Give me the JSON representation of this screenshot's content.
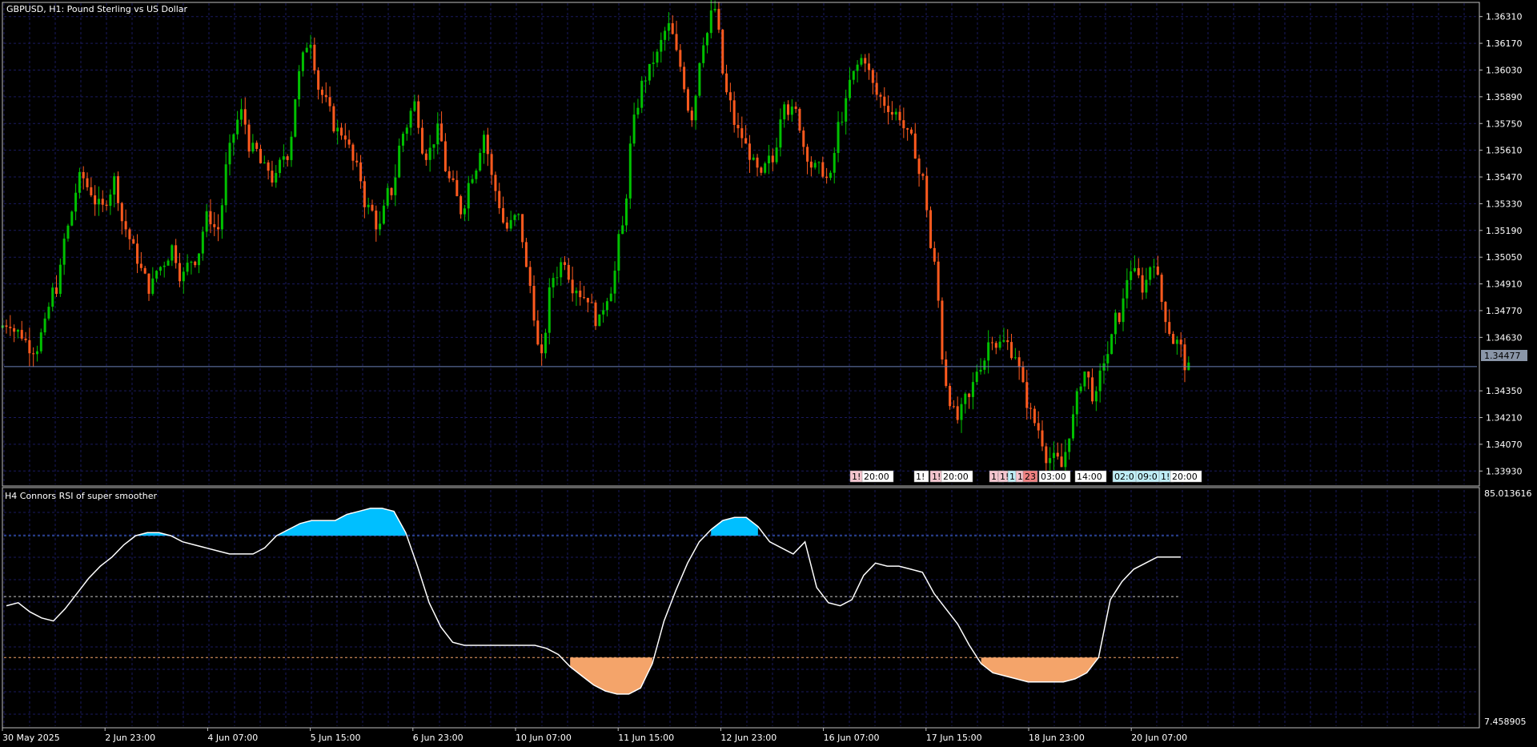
{
  "window": {
    "main_title": "GBPUSD, H1:  Pound Sterling vs US Dollar",
    "indicator_title": "H4 Connors RSI of super smoother"
  },
  "colors": {
    "background": "#000000",
    "frame": "#c0c0c0",
    "grid": "#1a1a5e",
    "bull": "#00c000",
    "bear": "#ff5a1e",
    "price_line": "#6a7fb8",
    "price_label_bg": "#8a96a8",
    "rsi_line": "#ffffff",
    "fill_high": "#00bfff",
    "fill_low": "#f4a46a",
    "level_top": "#3f6fd8",
    "level_mid": "#c8c8c8",
    "level_low": "#f4a46a"
  },
  "price_axis": {
    "labels": [
      "1.36310",
      "1.36170",
      "1.36030",
      "1.35890",
      "1.35750",
      "1.35610",
      "1.35470",
      "1.35330",
      "1.35190",
      "1.35050",
      "1.34910",
      "1.34770",
      "1.34630",
      "1.34350",
      "1.34210",
      "1.34070",
      "1.33930"
    ],
    "current_price": "1.34477"
  },
  "indicator_axis": {
    "max_label": "85.013616",
    "min_label": "7.458905"
  },
  "time_axis": {
    "labels": [
      "30 May 2025",
      "2 Jun 23:00",
      "4 Jun 07:00",
      "5 Jun 15:00",
      "6 Jun 23:00",
      "10 Jun 07:00",
      "11 Jun 15:00",
      "12 Jun 23:00",
      "16 Jun 07:00",
      "17 Jun 15:00",
      "18 Jun 23:00",
      "20 Jun 07:00"
    ]
  },
  "event_tags": [
    {
      "text": "1!",
      "style": "pink"
    },
    {
      "text": "20:00",
      "style": "white"
    },
    {
      "text": "1!",
      "style": "white"
    },
    {
      "text": "1!",
      "style": "pink"
    },
    {
      "text": "20:00",
      "style": "white"
    },
    {
      "text": "1!",
      "style": "pink"
    },
    {
      "text": "1!",
      "style": "pink"
    },
    {
      "text": "1!",
      "style": "cyan"
    },
    {
      "text": "1!",
      "style": "pink"
    },
    {
      "text": "23",
      "style": "red"
    },
    {
      "text": "03:00",
      "style": "white"
    },
    {
      "text": "14:00",
      "style": "white"
    },
    {
      "text": "02:0",
      "style": "cyan"
    },
    {
      "text": "09:0",
      "style": "cyan"
    },
    {
      "text": "1!",
      "style": "cyan"
    },
    {
      "text": "20:00",
      "style": "white"
    }
  ],
  "chart_data": [
    {
      "type": "candlestick",
      "title": "GBPUSD, H1:  Pound Sterling vs US Dollar",
      "ylim": [
        1.3386,
        1.3638
      ],
      "current_price": 1.34477,
      "x_range": [
        "30 May 2025",
        "20 Jun 2025"
      ],
      "grid": true,
      "closes": [
        1.3472,
        1.3465,
        1.3458,
        1.3468,
        1.349,
        1.352,
        1.3545,
        1.354,
        1.353,
        1.3545,
        1.352,
        1.3505,
        1.349,
        1.35,
        1.351,
        1.3495,
        1.3505,
        1.3525,
        1.352,
        1.356,
        1.358,
        1.356,
        1.355,
        1.3545,
        1.356,
        1.36,
        1.362,
        1.359,
        1.3575,
        1.357,
        1.355,
        1.353,
        1.352,
        1.354,
        1.357,
        1.3585,
        1.356,
        1.357,
        1.3545,
        1.353,
        1.355,
        1.357,
        1.354,
        1.352,
        1.3525,
        1.349,
        1.345,
        1.3495,
        1.3505,
        1.349,
        1.3485,
        1.347,
        1.349,
        1.352,
        1.3575,
        1.36,
        1.361,
        1.3625,
        1.3605,
        1.358,
        1.362,
        1.3635,
        1.359,
        1.357,
        1.356,
        1.3545,
        1.3555,
        1.359,
        1.358,
        1.356,
        1.355,
        1.3545,
        1.358,
        1.36,
        1.361,
        1.359,
        1.3585,
        1.358,
        1.3565,
        1.3545,
        1.35,
        1.344,
        1.342,
        1.343,
        1.345,
        1.3465,
        1.346,
        1.3455,
        1.343,
        1.3415,
        1.34,
        1.3395,
        1.342,
        1.3445,
        1.343,
        1.3455,
        1.3475,
        1.35,
        1.349,
        1.3505,
        1.3475,
        1.346,
        1.3445
      ],
      "series": [
        {
          "name": "GBPUSD",
          "values": "closes"
        }
      ]
    },
    {
      "type": "area",
      "title": "H4 Connors RSI of super smoother",
      "ylim": [
        7.458905,
        85.013616
      ],
      "levels": [
        70,
        50,
        30
      ],
      "grid": true,
      "values": [
        47,
        48,
        45,
        43,
        42,
        46,
        51,
        56,
        60,
        63,
        67,
        70,
        71,
        71,
        70,
        68,
        67,
        66,
        65,
        64,
        64,
        64,
        66,
        70,
        72,
        74,
        75,
        75,
        75,
        77,
        78,
        79,
        79,
        78,
        71,
        60,
        48,
        40,
        35,
        34,
        34,
        34,
        34,
        34,
        34,
        34,
        33,
        31,
        27,
        24,
        21,
        19,
        18,
        18,
        20,
        28,
        42,
        52,
        61,
        68,
        72,
        75,
        76,
        76,
        73,
        68,
        66,
        64,
        68,
        53,
        48,
        47,
        49,
        57,
        61,
        60,
        60,
        59,
        58,
        51,
        46,
        41,
        34,
        28,
        25,
        24,
        23,
        22,
        22,
        22,
        22,
        23,
        25,
        30,
        49,
        55,
        59,
        61,
        63,
        63,
        63
      ],
      "series": [
        {
          "name": "Connors RSI",
          "values": "values"
        }
      ]
    }
  ]
}
